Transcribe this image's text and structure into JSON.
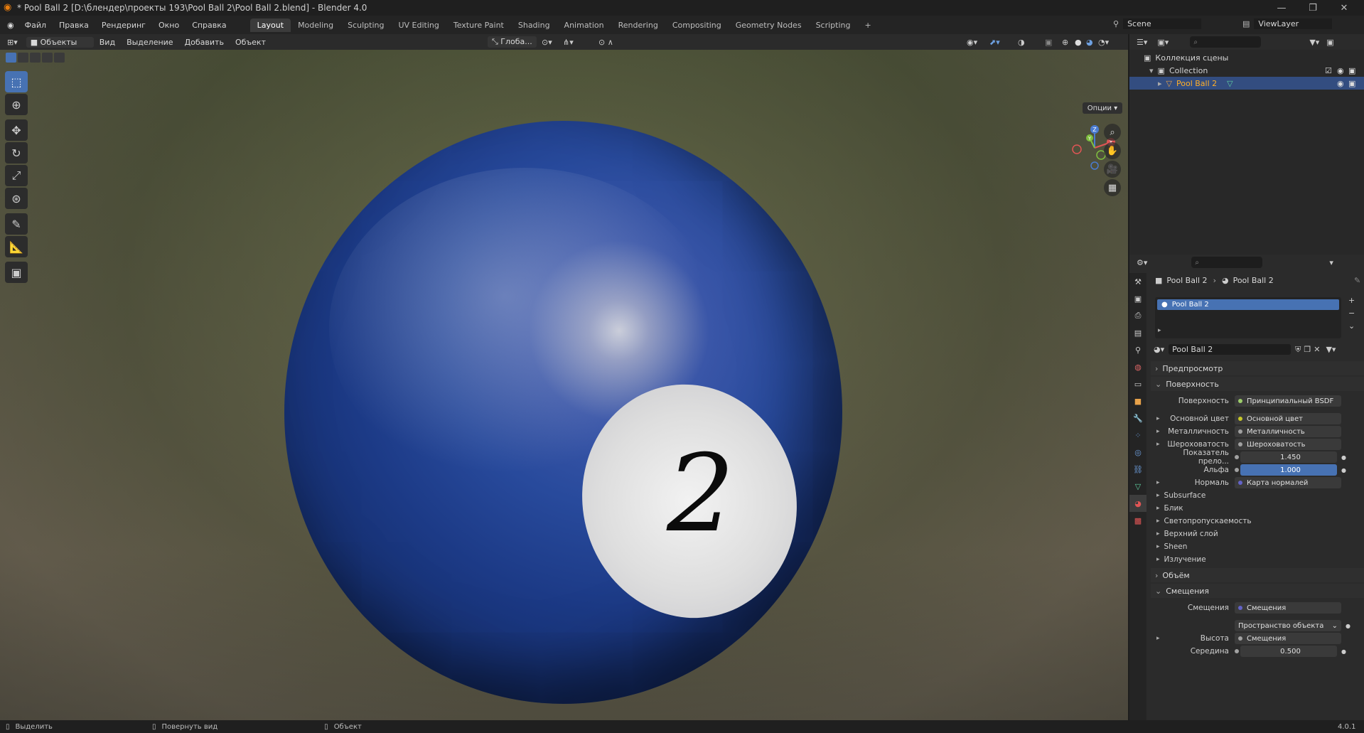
{
  "window": {
    "title": "* Pool Ball 2 [D:\\блендер\\проекты 193\\Pool Ball 2\\Pool Ball 2.blend] - Blender 4.0"
  },
  "menu": [
    "Файл",
    "Правка",
    "Рендеринг",
    "Окно",
    "Справка"
  ],
  "workspaces": [
    "Layout",
    "Modeling",
    "Sculpting",
    "UV Editing",
    "Texture Paint",
    "Shading",
    "Animation",
    "Rendering",
    "Compositing",
    "Geometry Nodes",
    "Scripting"
  ],
  "scene": {
    "scene_name": "Scene",
    "view_layer": "ViewLayer"
  },
  "viewport_header": {
    "mode": "Объекты",
    "items": [
      "Вид",
      "Выделение",
      "Добавить",
      "Объект"
    ],
    "orientation": "Глоба...",
    "options": "Опции"
  },
  "viewport": {
    "ball_number": "2"
  },
  "gizmo": {
    "z": "Z",
    "y": "Y",
    "x": "X"
  },
  "outliner": {
    "root": "Коллекция сцены",
    "collection": "Collection",
    "object": "Pool Ball 2"
  },
  "properties": {
    "breadcrumb_object": "Pool Ball 2",
    "breadcrumb_material": "Pool Ball 2",
    "material_slot": "Pool Ball 2",
    "material_name": "Pool Ball 2",
    "panels": {
      "preview": "Предпросмотр",
      "surface": "Поверхность",
      "volume": "Объём",
      "displacement": "Смещения"
    },
    "surface_rows": [
      {
        "label": "Поверхность",
        "value": "Принципиальный BSDF",
        "dot": "#9dcd6b"
      },
      {
        "label": "Основной цвет",
        "value": "Основной цвет",
        "dot": "#c7c729"
      },
      {
        "label": "Металличность",
        "value": "Металличность",
        "dot": "#a1a1a1"
      },
      {
        "label": "Шероховатость",
        "value": "Шероховатость",
        "dot": "#a1a1a1"
      },
      {
        "label": "Показатель прело...",
        "value": "1.450",
        "dot": "#a1a1a1"
      },
      {
        "label": "Альфа",
        "value": "1.000",
        "dot": "#a1a1a1"
      },
      {
        "label": "Нормаль",
        "value": "Карта нормалей",
        "dot": "#6363c7"
      }
    ],
    "subpanels": [
      "Subsurface",
      "Блик",
      "Светопропускаемость",
      "Верхний слой",
      "Sheen",
      "Излучение"
    ],
    "displacement_rows": [
      {
        "label": "Смещения",
        "value": "Смещения",
        "dot": "#6363c7"
      },
      {
        "label": "",
        "value": "Пространство объекта"
      },
      {
        "label": "Высота",
        "value": "Смещения",
        "dot": "#a1a1a1"
      },
      {
        "label": "Середина",
        "value": "0.500",
        "dot": "#a1a1a1"
      }
    ]
  },
  "statusbar": {
    "select": "Выделить",
    "rotate": "Повернуть вид",
    "object": "Объект",
    "version": "4.0.1"
  },
  "colors": {
    "accent": "#4772b3",
    "ball": "#1c3a86"
  }
}
